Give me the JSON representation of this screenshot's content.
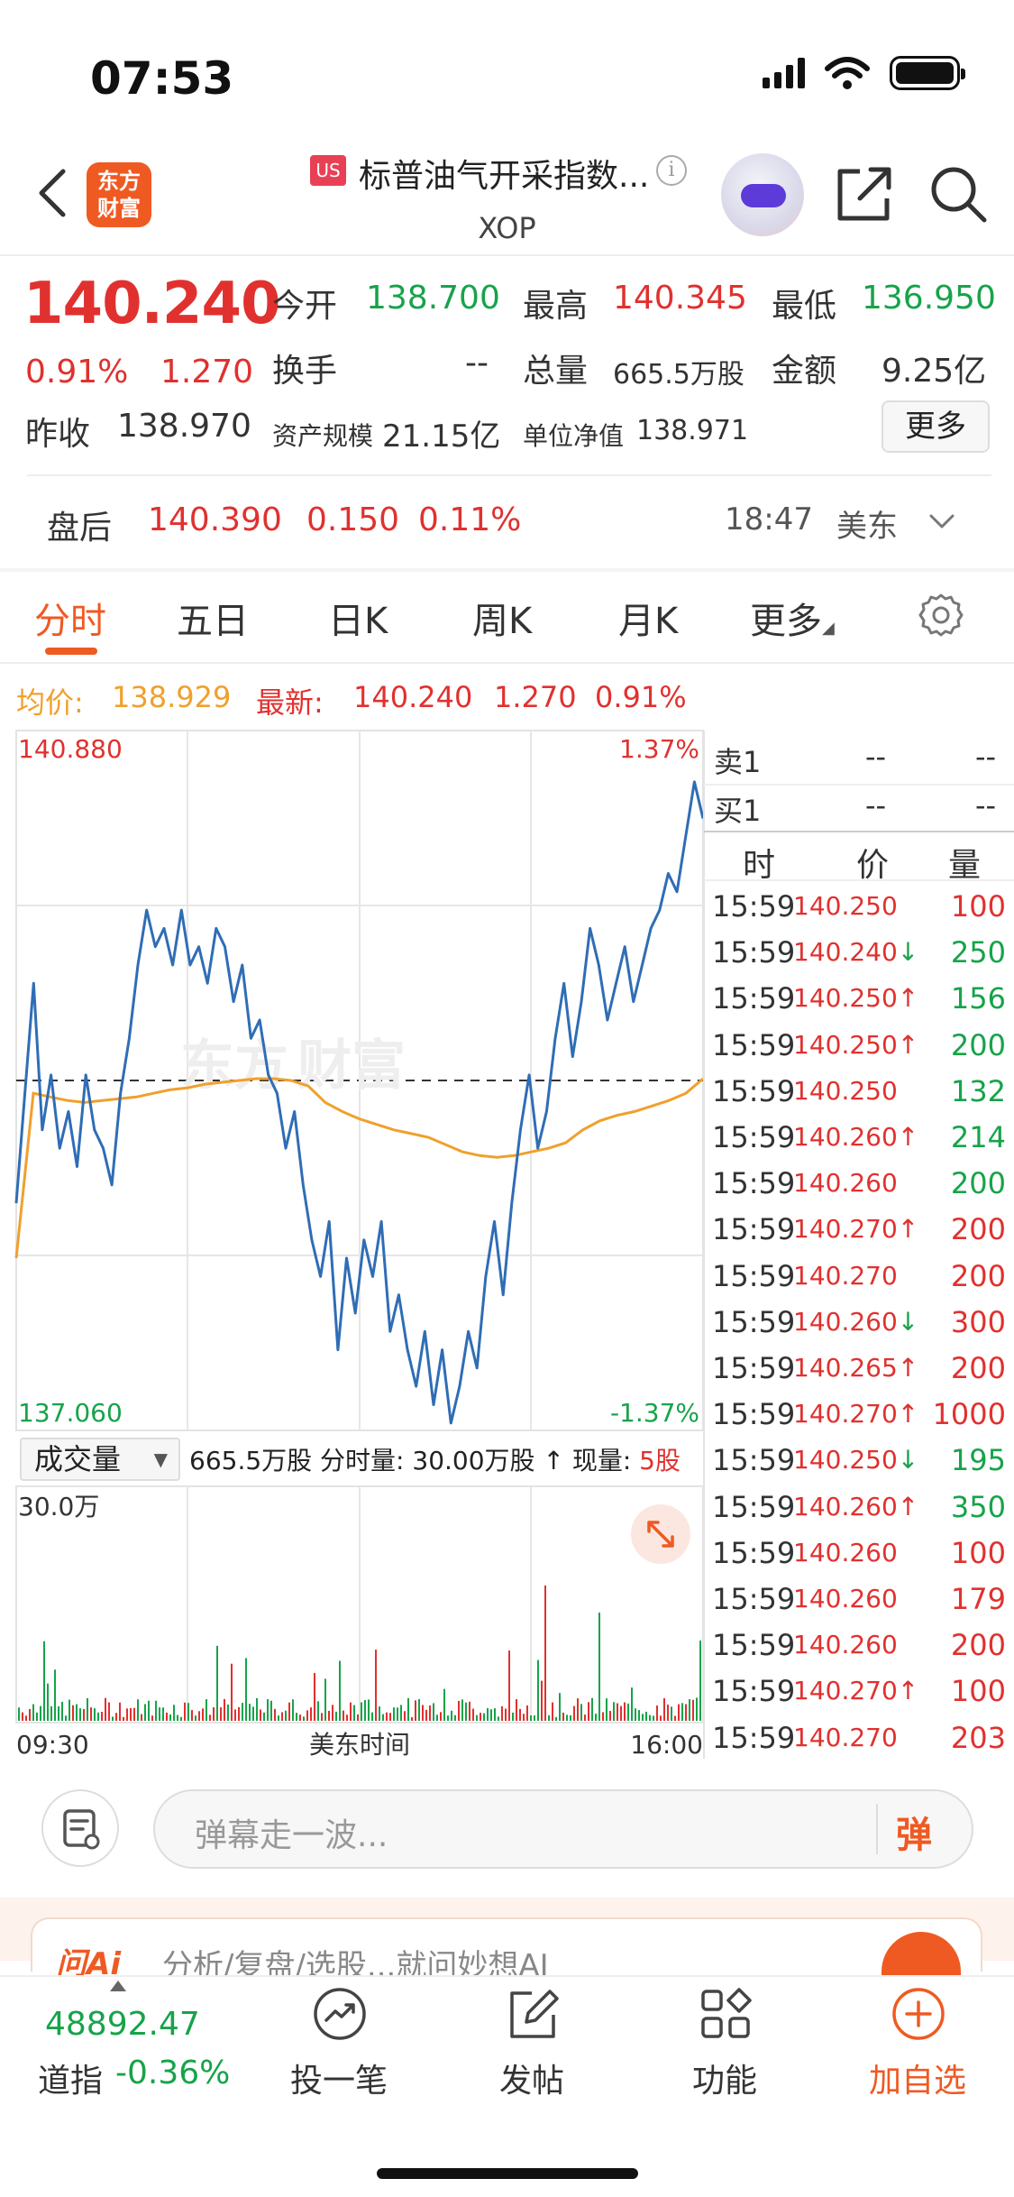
{
  "status_bar": {
    "time": "07:53"
  },
  "header": {
    "logo_line1": "东方",
    "logo_line2": "财富",
    "market_badge": "US",
    "title": "标普油气开采指数...",
    "ticker": "XOP"
  },
  "quote": {
    "price": "140.240",
    "change_pct": "0.91%",
    "change": "1.270",
    "open_label": "今开",
    "open": "138.700",
    "high_label": "最高",
    "high": "140.345",
    "low_label": "最低",
    "low": "136.950",
    "turnover_label": "换手",
    "turnover": "--",
    "volume_label": "总量",
    "volume": "665.5万股",
    "amount_label": "金额",
    "amount": "9.25亿",
    "prev_close_label": "昨收",
    "prev_close": "138.970",
    "asset_label": "资产规模",
    "asset": "21.15亿",
    "nav_label": "单位净值",
    "nav": "138.971",
    "more_label": "更多"
  },
  "after_hours": {
    "label": "盘后",
    "price": "140.390",
    "change": "0.150",
    "change_pct": "0.11%",
    "time": "18:47",
    "zone": "美东"
  },
  "tabs": [
    {
      "label": "分时",
      "active": true
    },
    {
      "label": "五日"
    },
    {
      "label": "日K"
    },
    {
      "label": "周K"
    },
    {
      "label": "月K"
    },
    {
      "label": "更多"
    }
  ],
  "legend": {
    "avg_label": "均价:",
    "avg_value": "138.929",
    "last_label": "最新:",
    "last_value": "140.240",
    "last_change": "1.270",
    "last_pct": "0.91%"
  },
  "chart_data": {
    "type": "line",
    "title": "",
    "xlabel": "美东时间",
    "x_ticks": [
      "09:30",
      "16:00"
    ],
    "ylim": [
      137.06,
      140.88
    ],
    "y_top_label": "140.880",
    "y_bottom_label": "137.060",
    "pct_top_label": "1.37%",
    "pct_bottom_label": "-1.37%",
    "prev_close": 138.97,
    "series": [
      {
        "color": "#2f6db5",
        "values": [
          138.3,
          138.9,
          139.5,
          138.7,
          139.0,
          138.6,
          138.8,
          138.5,
          139.0,
          138.7,
          138.6,
          138.4,
          138.9,
          139.2,
          139.6,
          139.9,
          139.7,
          139.8,
          139.6,
          139.9,
          139.6,
          139.7,
          139.5,
          139.8,
          139.7,
          139.4,
          139.6,
          139.2,
          139.3,
          139.0,
          138.9,
          138.6,
          138.8,
          138.4,
          138.1,
          137.9,
          138.2,
          137.5,
          138.0,
          137.7,
          138.1,
          137.9,
          138.2,
          137.6,
          137.8,
          137.5,
          137.3,
          137.6,
          137.2,
          137.5,
          137.1,
          137.3,
          137.6,
          137.4,
          137.9,
          138.2,
          137.8,
          138.3,
          138.7,
          139.0,
          138.6,
          138.8,
          139.2,
          139.5,
          139.1,
          139.4,
          139.8,
          139.6,
          139.3,
          139.5,
          139.7,
          139.4,
          139.6,
          139.8,
          139.9,
          140.1,
          140.0,
          140.3,
          140.6,
          140.4
        ],
        "name": ""
      },
      {
        "color": "#f0a02c",
        "values": [
          138.0,
          138.9,
          138.88,
          138.86,
          138.85,
          138.86,
          138.87,
          138.88,
          138.9,
          138.92,
          138.93,
          138.95,
          138.96,
          138.97,
          138.98,
          138.98,
          138.97,
          138.94,
          138.85,
          138.8,
          138.76,
          138.73,
          138.7,
          138.68,
          138.66,
          138.62,
          138.58,
          138.56,
          138.55,
          138.56,
          138.58,
          138.6,
          138.63,
          138.7,
          138.75,
          138.78,
          138.8,
          138.83,
          138.86,
          138.9,
          138.98
        ],
        "name": ""
      }
    ]
  },
  "order_book": {
    "ask_label": "卖1",
    "ask_price": "--",
    "ask_vol": "--",
    "bid_label": "买1",
    "bid_price": "--",
    "bid_vol": "--",
    "col_time": "时",
    "col_price": "价",
    "col_vol": "量"
  },
  "time_sales": [
    {
      "time": "15:59",
      "price": "140.250",
      "dir": "",
      "vol": "100",
      "color": "#e0312f"
    },
    {
      "time": "15:59",
      "price": "140.240↓",
      "dir": "down",
      "vol": "250",
      "color": "#17a34a"
    },
    {
      "time": "15:59",
      "price": "140.250↑",
      "dir": "up",
      "vol": "156",
      "color": "#17a34a"
    },
    {
      "time": "15:59",
      "price": "140.250↑",
      "dir": "up",
      "vol": "200",
      "color": "#17a34a"
    },
    {
      "time": "15:59",
      "price": "140.250",
      "dir": "",
      "vol": "132",
      "color": "#17a34a"
    },
    {
      "time": "15:59",
      "price": "140.260↑",
      "dir": "up",
      "vol": "214",
      "color": "#17a34a"
    },
    {
      "time": "15:59",
      "price": "140.260",
      "dir": "",
      "vol": "200",
      "color": "#17a34a"
    },
    {
      "time": "15:59",
      "price": "140.270↑",
      "dir": "up",
      "vol": "200",
      "color": "#e0312f"
    },
    {
      "time": "15:59",
      "price": "140.270",
      "dir": "",
      "vol": "200",
      "color": "#e0312f"
    },
    {
      "time": "15:59",
      "price": "140.260↓",
      "dir": "down",
      "vol": "300",
      "color": "#e0312f"
    },
    {
      "time": "15:59",
      "price": "140.265↑",
      "dir": "up",
      "vol": "200",
      "color": "#e0312f"
    },
    {
      "time": "15:59",
      "price": "140.270↑",
      "dir": "up",
      "vol": "1000",
      "color": "#e0312f"
    },
    {
      "time": "15:59",
      "price": "140.250↓",
      "dir": "down",
      "vol": "195",
      "color": "#17a34a"
    },
    {
      "time": "15:59",
      "price": "140.260↑",
      "dir": "up",
      "vol": "350",
      "color": "#17a34a"
    },
    {
      "time": "15:59",
      "price": "140.260",
      "dir": "",
      "vol": "100",
      "color": "#e0312f"
    },
    {
      "time": "15:59",
      "price": "140.260",
      "dir": "",
      "vol": "179",
      "color": "#e0312f"
    },
    {
      "time": "15:59",
      "price": "140.260",
      "dir": "",
      "vol": "200",
      "color": "#e0312f"
    },
    {
      "time": "15:59",
      "price": "140.270↑",
      "dir": "up",
      "vol": "100",
      "color": "#e0312f"
    },
    {
      "time": "15:59",
      "price": "140.270",
      "dir": "",
      "vol": "203",
      "color": "#e0312f"
    }
  ],
  "volume_panel": {
    "selector_label": "成交量",
    "info_prefix": "665.5万股 分时量: 30.00万股 ↑ 现量:",
    "current_vol": "5股",
    "y_top_label": "30.0万"
  },
  "comment": {
    "placeholder": "弹幕走一波...",
    "danmu_button": "弹"
  },
  "promo": {
    "logo": "问Ai",
    "text": "分析/复盘/选股...就问妙想AI"
  },
  "bottom_nav": {
    "index_value": "48892.47",
    "index_name": "道指",
    "index_change": "-0.36%",
    "items": [
      {
        "label": "投一笔",
        "icon": "trend-chart-icon"
      },
      {
        "label": "发帖",
        "icon": "compose-icon"
      },
      {
        "label": "功能",
        "icon": "grid-icon"
      },
      {
        "label": "加自选",
        "icon": "add-circle-icon"
      }
    ]
  },
  "colors": {
    "up": "#e0312f",
    "down": "#17a34a",
    "accent": "#ef5a22",
    "price_line": "#2f6db5",
    "avg_line": "#f0a02c"
  }
}
